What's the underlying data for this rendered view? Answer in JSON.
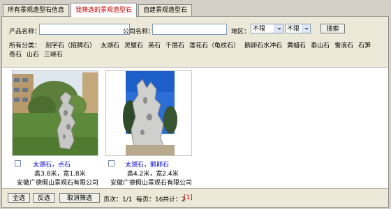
{
  "tabs": [
    "所有景观造型石信息",
    "我筛选的景观造型石",
    "自建景观造型石"
  ],
  "filter": {
    "product_label": "产品名称：",
    "company_label": "公司名称：",
    "region_label": "地区：",
    "region1": "不限",
    "region2": "不限",
    "search_label": "搜索",
    "cat_label": "所有分类：",
    "categories": [
      "刻字石（招牌石）",
      "太湖石",
      "灵璧石",
      "英石",
      "千层石",
      "莲花石（龟纹石）",
      "鹅卵石水冲石",
      "黄蜡石",
      "泰山石",
      "雪浪石",
      "石笋",
      "奇石",
      "山石",
      "三峡石"
    ]
  },
  "items": [
    {
      "name": "太湖石，点石",
      "size": "高3.8米，宽1.8米",
      "company": "安徽广德假山景观石有限公司"
    },
    {
      "name": "太湖石，鹅卵石",
      "size": "高4.2米，宽2.4米",
      "company": "安徽广德假山景观石有限公司"
    }
  ],
  "footer": {
    "select_all": "全选",
    "invert": "反选",
    "cancel": "取消筛选",
    "page_info": "页次：1/1",
    "per_page": "每页：16",
    "total": "共计：2",
    "page_link": "[1]"
  }
}
